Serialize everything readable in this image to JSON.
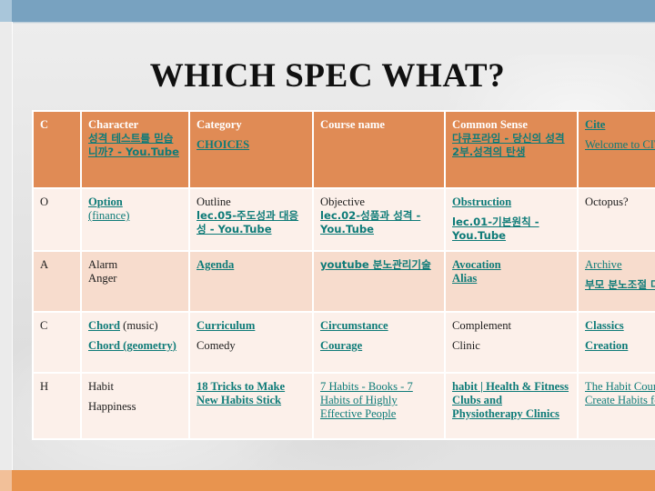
{
  "slide": {
    "title": "WHICH SPEC WHAT?",
    "accent_blue": "#78a2c0",
    "accent_blue_light": "#a9c6da",
    "accent_orange": "#e8944f",
    "header_orange": "#e08b55",
    "row_peach_dark": "#f7dccd",
    "row_peach_light": "#fcf0ea",
    "link_teal": "#0e7b78"
  },
  "table": {
    "columns": [
      "",
      "Character",
      "Category",
      "Course name",
      "Common Sense",
      "Cite"
    ],
    "header": {
      "letter": "C",
      "character_label": "Character",
      "character_link": "성격 테스트를 믿습니까? - You.Tube",
      "category_label": "Category",
      "category_link": "CHOICES",
      "course_label": "Course name",
      "common_label": "Common Sense",
      "common_link": "다큐프라임 - 당신의 성격 2부.성격의 탄생",
      "cite_link": "Cite",
      "cite_link2": "Welcome to CITES"
    },
    "rows": [
      {
        "letter": "O",
        "character": {
          "link": "Option",
          "link2": "(finance)"
        },
        "category": {
          "plain": "Outline",
          "link": "lec.05-주도성과 대응성 - You.Tube"
        },
        "course": {
          "plain": "Objective",
          "link": "lec.02-성품과 성격 - You.Tube"
        },
        "common": {
          "link": "Obstruction",
          "link2": "lec.01-기본원칙 - You.Tube"
        },
        "cite": {
          "plain": "Octopus?"
        }
      },
      {
        "letter": "A",
        "character": {
          "plain": "Alarm",
          "plain2": "Anger"
        },
        "category": {
          "link": "Agenda"
        },
        "course": {
          "link": "youtube 분노관리기술"
        },
        "common": {
          "link": "Avocation",
          "link2": "Alias"
        },
        "cite": {
          "link": "Archive",
          "link2": "부모 분노조절 다룰기술"
        }
      },
      {
        "letter": "C",
        "character": {
          "link": "Chord",
          "link_suffix": " (music)",
          "link2": "Chord (geometry)"
        },
        "category": {
          "link": "Curriculum",
          "plain2": "Comedy"
        },
        "course": {
          "link": "Circumstance",
          "link2": "Courage"
        },
        "common": {
          "plain": "Complement",
          "plain2": "Clinic"
        },
        "cite": {
          "link": "Classics",
          "link2": "Creation"
        }
      },
      {
        "letter": "H",
        "character": {
          "plain": "Habit",
          "plain2": "Happiness"
        },
        "category": {
          "link": "18 Tricks to Make New Habits Stick"
        },
        "course": {
          "link": "7 Habits - Books - 7 Habits of Highly Effective People"
        },
        "common": {
          "link": "habit | Health & Fitness Clubs and Physiotherapy Clinics"
        },
        "cite": {
          "link": "The Habit Course | Create Habits for Life"
        }
      }
    ]
  }
}
